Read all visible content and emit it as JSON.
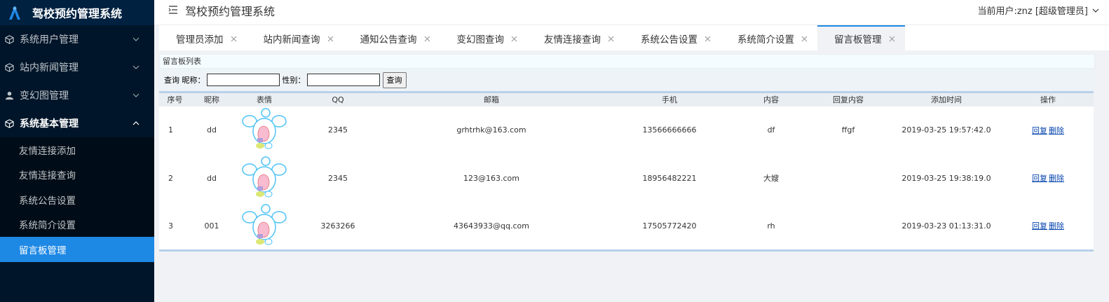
{
  "app": {
    "title": "驾校预约管理系统"
  },
  "header": {
    "title": "驾校预约管理系统",
    "current_user": "当前用户:znz [超级管理员]"
  },
  "sidebar": {
    "menus": [
      {
        "label": "系统用户管理",
        "icon": "cube-icon",
        "open": false
      },
      {
        "label": "站内新闻管理",
        "icon": "cube-icon",
        "open": false
      },
      {
        "label": "变幻图管理",
        "icon": "user-icon",
        "open": false
      },
      {
        "label": "系统基本管理",
        "icon": "cube-icon",
        "open": true
      }
    ],
    "submenu": [
      {
        "label": "友情连接添加",
        "active": false
      },
      {
        "label": "友情连接查询",
        "active": false
      },
      {
        "label": "系统公告设置",
        "active": false
      },
      {
        "label": "系统简介设置",
        "active": false
      },
      {
        "label": "留言板管理",
        "active": true
      }
    ]
  },
  "tabs": [
    {
      "label": "管理员添加",
      "active": false
    },
    {
      "label": "站内新闻查询",
      "active": false
    },
    {
      "label": "通知公告查询",
      "active": false
    },
    {
      "label": "变幻图查询",
      "active": false
    },
    {
      "label": "友情连接查询",
      "active": false
    },
    {
      "label": "系统公告设置",
      "active": false
    },
    {
      "label": "系统简介设置",
      "active": false
    },
    {
      "label": "留言板管理",
      "active": true
    }
  ],
  "panel": {
    "title": "留言板列表"
  },
  "search": {
    "prefix": "查询 昵称：",
    "nickname_value": "",
    "gender_label": "性别：",
    "gender_value": "",
    "button": "查询"
  },
  "table": {
    "columns": [
      "序号",
      "昵称",
      "表情",
      "QQ",
      "邮箱",
      "手机",
      "内容",
      "回复内容",
      "添加时间",
      "操作"
    ],
    "rows": [
      {
        "seq": "1",
        "nickname": "dd",
        "emoji": "cartoon-mouse-icon",
        "qq": "2345",
        "email": "grhtrhk@163.com",
        "phone": "13566666666",
        "content": "df",
        "reply": "ffgf",
        "time": "2019-03-25 19:57:42.0",
        "op_reply": "回复",
        "op_delete": "删除"
      },
      {
        "seq": "2",
        "nickname": "dd",
        "emoji": "cartoon-mouse-icon",
        "qq": "2345",
        "email": "123@163.com",
        "phone": "18956482221",
        "content": "大嫂",
        "reply": "",
        "time": "2019-03-25 19:38:19.0",
        "op_reply": "回复",
        "op_delete": "删除"
      },
      {
        "seq": "3",
        "nickname": "001",
        "emoji": "cartoon-mouse-icon",
        "qq": "3263266",
        "email": "43643933@qq.com",
        "phone": "17505772420",
        "content": "rh",
        "reply": "",
        "time": "2019-03-23 01:13:31.0",
        "op_reply": "回复",
        "op_delete": "删除"
      }
    ]
  },
  "colors": {
    "sidebar_bg": "#001529",
    "accent": "#1e88e5",
    "link": "#0645ad"
  }
}
